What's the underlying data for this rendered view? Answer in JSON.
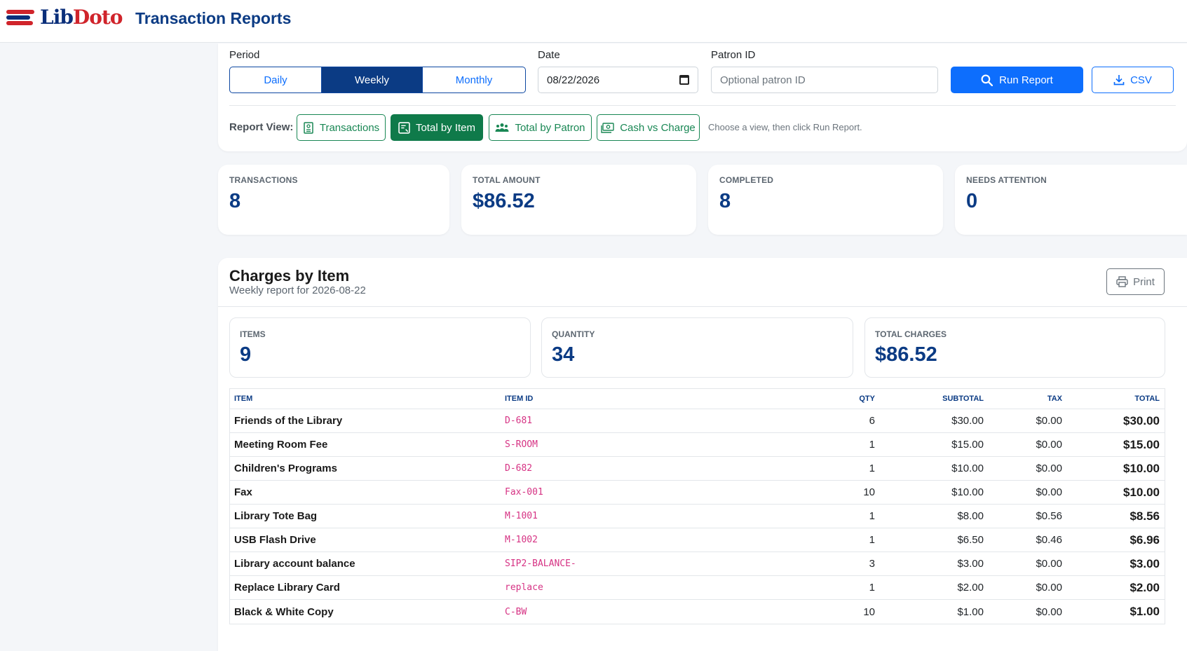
{
  "header": {
    "logo_lib": "Lib",
    "logo_doto": "Doto",
    "title": "Transaction Reports"
  },
  "filters": {
    "period_label": "Period",
    "periods": [
      "Daily",
      "Weekly",
      "Monthly"
    ],
    "selected_period": "Weekly",
    "date_label": "Date",
    "date_value": "08/22/2026",
    "patron_label": "Patron ID",
    "patron_placeholder": "Optional patron ID",
    "run_label": "Run Report",
    "csv_label": "CSV",
    "report_view_label": "Report View:",
    "views": [
      "Transactions",
      "Total by Item",
      "Total by Patron",
      "Cash vs Charge"
    ],
    "selected_view": "Total by Item",
    "hint": "Choose a view, then click Run Report."
  },
  "stats": [
    {
      "label": "TRANSACTIONS",
      "value": "8"
    },
    {
      "label": "TOTAL AMOUNT",
      "value": "$86.52"
    },
    {
      "label": "COMPLETED",
      "value": "8"
    },
    {
      "label": "NEEDS ATTENTION",
      "value": "0"
    }
  ],
  "report": {
    "title": "Charges by Item",
    "subtitle": "Weekly report for 2026-08-22",
    "print_label": "Print",
    "summary": [
      {
        "label": "ITEMS",
        "value": "9"
      },
      {
        "label": "QUANTITY",
        "value": "34"
      },
      {
        "label": "TOTAL CHARGES",
        "value": "$86.52"
      }
    ],
    "columns": [
      "ITEM",
      "ITEM ID",
      "QTY",
      "SUBTOTAL",
      "TAX",
      "TOTAL"
    ],
    "rows": [
      {
        "item": "Friends of the Library",
        "id": "D-681",
        "qty": "6",
        "subtotal": "$30.00",
        "tax": "$0.00",
        "total": "$30.00"
      },
      {
        "item": "Meeting Room Fee",
        "id": "S-ROOM",
        "qty": "1",
        "subtotal": "$15.00",
        "tax": "$0.00",
        "total": "$15.00"
      },
      {
        "item": "Children's Programs",
        "id": "D-682",
        "qty": "1",
        "subtotal": "$10.00",
        "tax": "$0.00",
        "total": "$10.00"
      },
      {
        "item": "Fax",
        "id": "Fax-001",
        "qty": "10",
        "subtotal": "$10.00",
        "tax": "$0.00",
        "total": "$10.00"
      },
      {
        "item": "Library Tote Bag",
        "id": "M-1001",
        "qty": "1",
        "subtotal": "$8.00",
        "tax": "$0.56",
        "total": "$8.56"
      },
      {
        "item": "USB Flash Drive",
        "id": "M-1002",
        "qty": "1",
        "subtotal": "$6.50",
        "tax": "$0.46",
        "total": "$6.96"
      },
      {
        "item": "Library account balance",
        "id": "SIP2-BALANCE-",
        "qty": "3",
        "subtotal": "$3.00",
        "tax": "$0.00",
        "total": "$3.00"
      },
      {
        "item": "Replace Library Card",
        "id": "replace",
        "qty": "1",
        "subtotal": "$2.00",
        "tax": "$0.00",
        "total": "$2.00"
      },
      {
        "item": "Black & White Copy",
        "id": "C-BW",
        "qty": "10",
        "subtotal": "$1.00",
        "tax": "$0.00",
        "total": "$1.00"
      }
    ]
  },
  "icons": {
    "run": "search-icon",
    "csv": "download-icon",
    "print": "printer-icon"
  },
  "colors": {
    "primary": "#0d6efd",
    "navy": "#0b3b84",
    "success": "#198754",
    "brand_red": "#d0242b"
  }
}
